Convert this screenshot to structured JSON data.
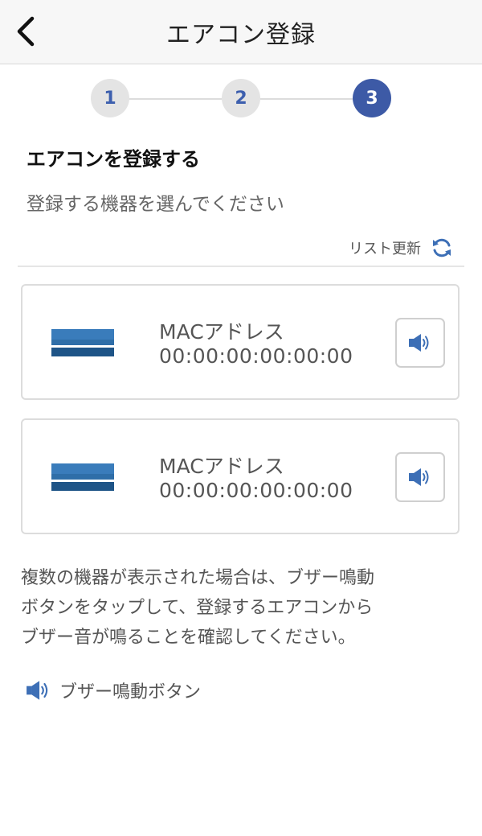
{
  "header": {
    "title": "エアコン登録",
    "back_icon": "chevron-left-icon"
  },
  "steps": {
    "items": [
      "1",
      "2",
      "3"
    ],
    "current": "3",
    "active_color": "#3d5aa6"
  },
  "section": {
    "title": "エアコンを登録する",
    "subtitle": "登録する機器を選んでください"
  },
  "refresh": {
    "label": "リスト更新",
    "icon": "refresh-icon"
  },
  "devices": [
    {
      "mac_label": "MACアドレス",
      "mac_value": "00:00:00:00:00:00",
      "icon": "air-conditioner-icon",
      "button_icon": "speaker-icon"
    },
    {
      "mac_label": "MACアドレス",
      "mac_value": "00:00:00:00:00:00",
      "icon": "air-conditioner-icon",
      "button_icon": "speaker-icon"
    }
  ],
  "note": {
    "lines": [
      "複数の機器が表示された場合は、ブザー鳴動",
      "ボタンをタップして、登録するエアコンから",
      "ブザー音が鳴ることを確認してください。"
    ]
  },
  "legend": {
    "label": "ブザー鳴動ボタン",
    "icon": "speaker-icon"
  },
  "colors": {
    "accent": "#3d5aa6",
    "ac_blue": "#2f6ea8"
  }
}
